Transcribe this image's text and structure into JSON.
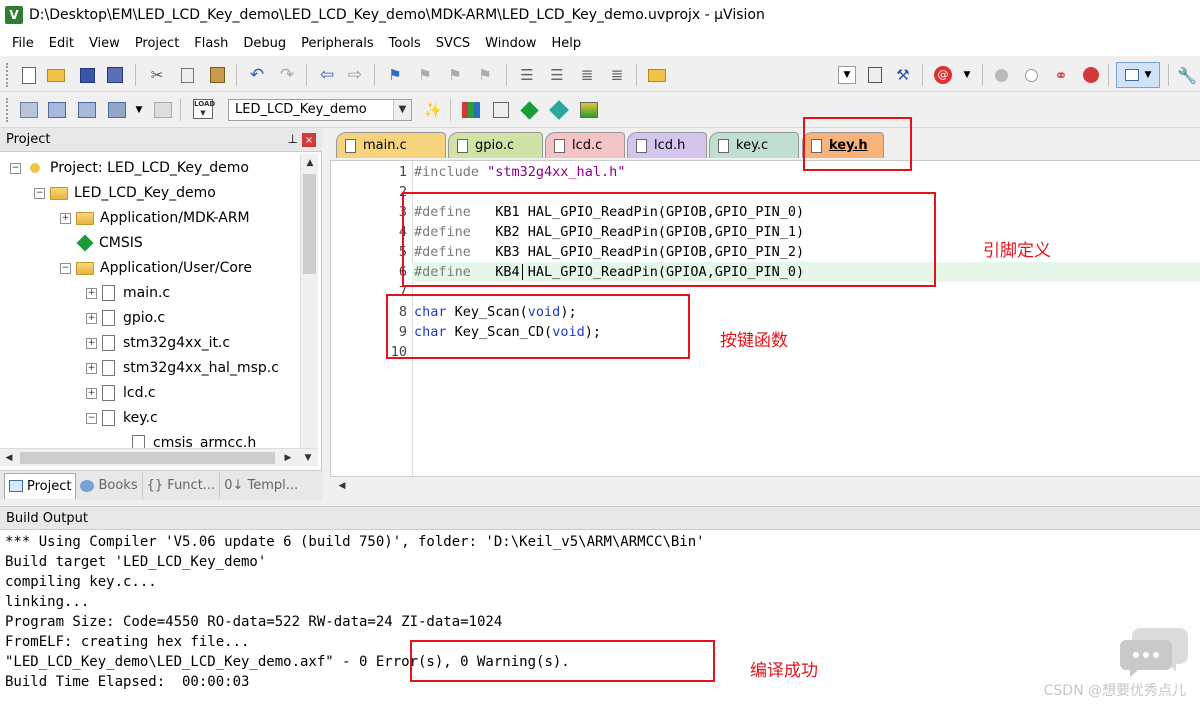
{
  "window": {
    "title": "D:\\Desktop\\EM\\LED_LCD_Key_demo\\LED_LCD_Key_demo\\MDK-ARM\\LED_LCD_Key_demo.uvprojx - µVision",
    "app_icon": "V"
  },
  "menu": [
    "File",
    "Edit",
    "View",
    "Project",
    "Flash",
    "Debug",
    "Peripherals",
    "Tools",
    "SVCS",
    "Window",
    "Help"
  ],
  "toolbar2": {
    "target": "LED_LCD_Key_demo"
  },
  "project_panel": {
    "title": "Project",
    "close_glyph": "×",
    "pin_glyph": "⊥",
    "tree": [
      {
        "label": "Project: LED_LCD_Key_demo",
        "expander": "−",
        "icon": "project-icon",
        "level": 0
      },
      {
        "label": "LED_LCD_Key_demo",
        "expander": "−",
        "icon": "target-icon",
        "level": 1
      },
      {
        "label": "Application/MDK-ARM",
        "expander": "+",
        "icon": "folder-icon",
        "level": 2
      },
      {
        "label": "CMSIS",
        "expander": "",
        "icon": "cmsis-icon",
        "level": 2
      },
      {
        "label": "Application/User/Core",
        "expander": "−",
        "icon": "folder-icon",
        "level": 2
      },
      {
        "label": "main.c",
        "expander": "+",
        "icon": "file-icon",
        "level": 3
      },
      {
        "label": "gpio.c",
        "expander": "+",
        "icon": "file-icon",
        "level": 3
      },
      {
        "label": "stm32g4xx_it.c",
        "expander": "+",
        "icon": "file-icon",
        "level": 3
      },
      {
        "label": "stm32g4xx_hal_msp.c",
        "expander": "+",
        "icon": "file-icon",
        "level": 3
      },
      {
        "label": "lcd.c",
        "expander": "+",
        "icon": "file-icon",
        "level": 3
      },
      {
        "label": "key.c",
        "expander": "−",
        "icon": "file-icon",
        "level": 3
      },
      {
        "label": "cmsis_armcc.h",
        "expander": "",
        "icon": "file-icon",
        "level": 4
      }
    ],
    "tabs": [
      {
        "label": "Project",
        "active": true
      },
      {
        "label": "Books",
        "active": false
      },
      {
        "label": "{} Funct...",
        "active": false
      },
      {
        "label": "0↓ Templ...",
        "active": false
      }
    ]
  },
  "editor": {
    "tabs": [
      {
        "label": "main.c",
        "color": "#f7d37d",
        "active": false
      },
      {
        "label": "gpio.c",
        "color": "#cfe3a6",
        "active": false
      },
      {
        "label": "lcd.c",
        "color": "#f4c3c3",
        "active": false
      },
      {
        "label": "lcd.h",
        "color": "#d4c5ef",
        "active": false
      },
      {
        "label": "key.c",
        "color": "#bfe0d0",
        "active": false
      },
      {
        "label": "key.h",
        "color": "#f7b37a",
        "active": true
      }
    ],
    "lines": [
      {
        "num": "1",
        "parts": [
          {
            "t": "#include ",
            "c": "kw-pre"
          },
          {
            "t": "\"stm32g4xx_hal.h\"",
            "c": "str"
          }
        ]
      },
      {
        "num": "2",
        "parts": []
      },
      {
        "num": "3",
        "parts": [
          {
            "t": "#define",
            "c": "kw-pre"
          },
          {
            "t": "   KB1 HAL_GPIO_ReadPin(GPIOB,GPIO_PIN_0)",
            "c": ""
          }
        ]
      },
      {
        "num": "4",
        "parts": [
          {
            "t": "#define",
            "c": "kw-pre"
          },
          {
            "t": "   KB2 HAL_GPIO_ReadPin(GPIOB,GPIO_PIN_1)",
            "c": ""
          }
        ]
      },
      {
        "num": "5",
        "parts": [
          {
            "t": "#define",
            "c": "kw-pre"
          },
          {
            "t": "   KB3 HAL_GPIO_ReadPin(GPIOB,GPIO_PIN_2)",
            "c": ""
          }
        ]
      },
      {
        "num": "6",
        "parts": [
          {
            "t": "#define",
            "c": "kw-pre"
          },
          {
            "t": "   KB4 HAL_GPIO_ReadPin(GPIOA,GPIO_PIN_0)",
            "c": ""
          }
        ]
      },
      {
        "num": "7",
        "parts": []
      },
      {
        "num": "8",
        "parts": [
          {
            "t": "char",
            "c": "kw-type"
          },
          {
            "t": " Key_Scan(",
            "c": ""
          },
          {
            "t": "void",
            "c": "kw-type"
          },
          {
            "t": ");",
            "c": ""
          }
        ]
      },
      {
        "num": "9",
        "parts": [
          {
            "t": "char",
            "c": "kw-type"
          },
          {
            "t": " Key_Scan_CD(",
            "c": ""
          },
          {
            "t": "void",
            "c": "kw-type"
          },
          {
            "t": ");",
            "c": ""
          }
        ]
      },
      {
        "num": "10",
        "parts": []
      }
    ],
    "current_line": 6
  },
  "build_output": {
    "title": "Build Output",
    "lines": [
      "*** Using Compiler 'V5.06 update 6 (build 750)', folder: 'D:\\Keil_v5\\ARM\\ARMCC\\Bin'",
      "Build target 'LED_LCD_Key_demo'",
      "compiling key.c...",
      "linking...",
      "Program Size: Code=4550 RO-data=522 RW-data=24 ZI-data=1024",
      "FromELF: creating hex file...",
      "\"LED_LCD_Key_demo\\LED_LCD_Key_demo.axf\" - 0 Error(s), 0 Warning(s).",
      "Build Time Elapsed:  00:00:03"
    ]
  },
  "annotations": {
    "pin_define": "引脚定义",
    "key_functions": "按键函数",
    "compile_success": "编译成功",
    "accent": "#e3131b"
  },
  "watermark": "CSDN @想要优秀点儿"
}
